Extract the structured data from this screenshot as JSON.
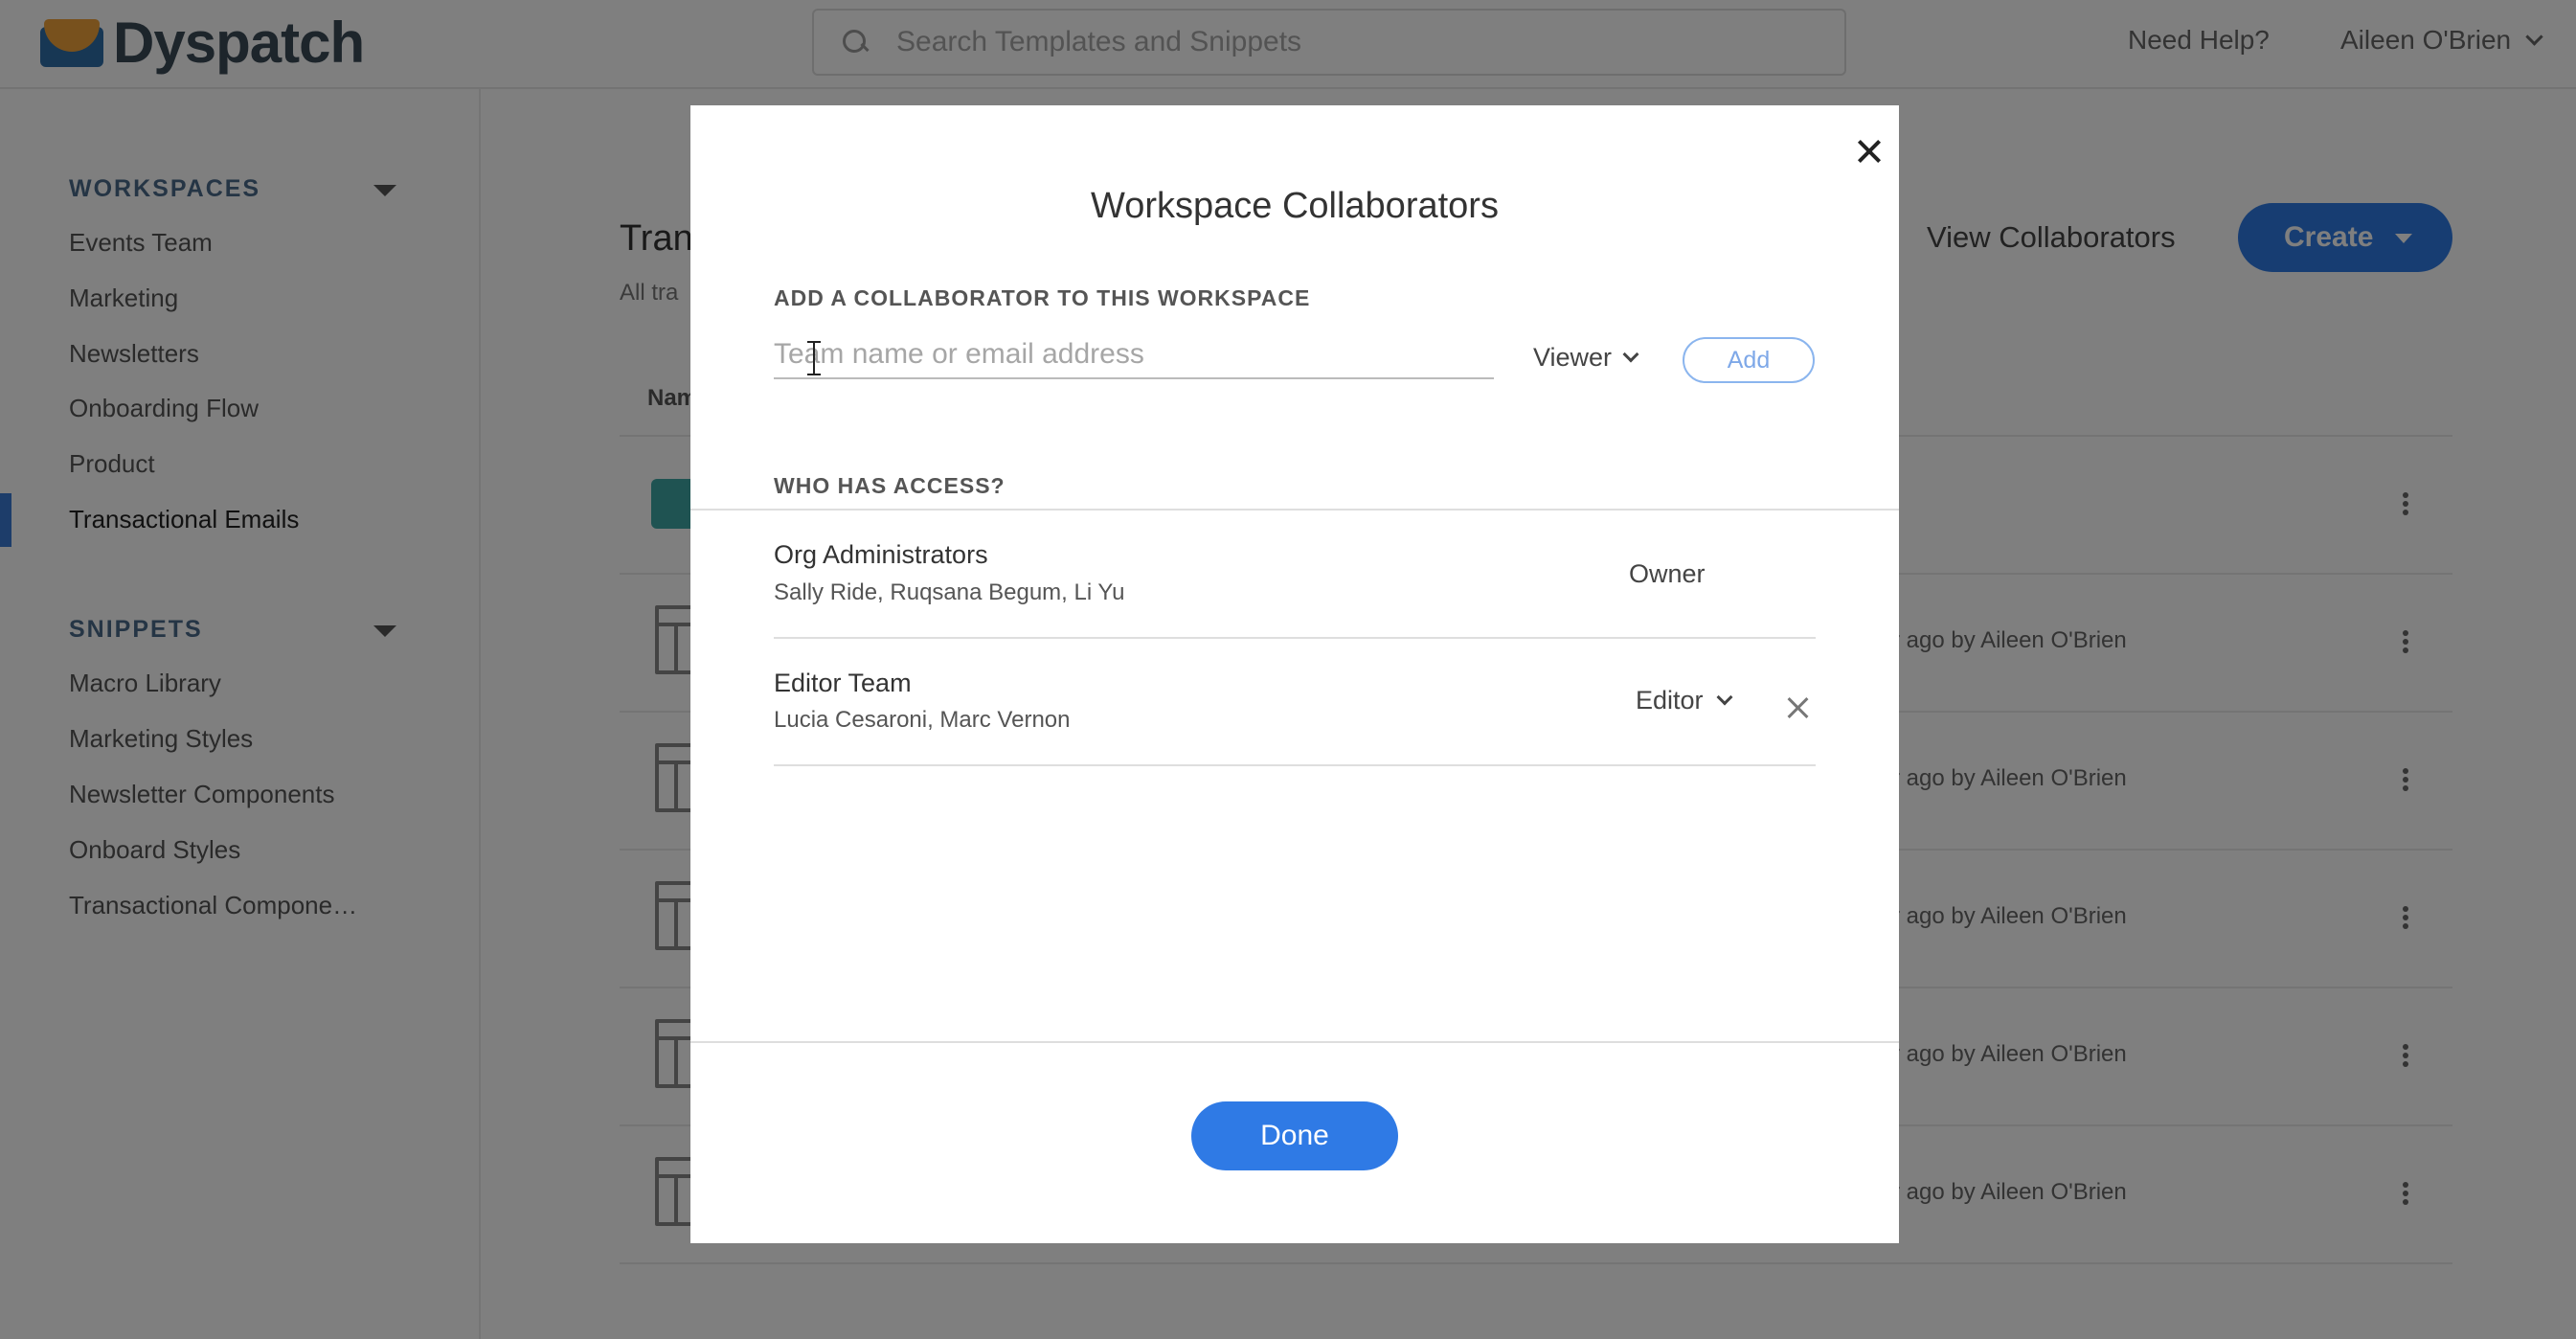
{
  "header": {
    "brand": "Dyspatch",
    "search_placeholder": "Search Templates and Snippets",
    "help_label": "Need Help?",
    "user_name": "Aileen O'Brien"
  },
  "sidebar": {
    "workspaces_title": "WORKSPACES",
    "workspaces": [
      "Events Team",
      "Marketing",
      "Newsletters",
      "Onboarding Flow",
      "Product",
      "Transactional Emails"
    ],
    "active_workspace": "Transactional Emails",
    "snippets_title": "SNIPPETS",
    "snippets": [
      "Macro Library",
      "Marketing Styles",
      "Newsletter Components",
      "Onboard Styles",
      "Transactional Compone…"
    ]
  },
  "main": {
    "title_partial": "Tran",
    "subtitle_partial": "All tra",
    "column_name_partial": "Nam",
    "view_collaborators_label": "View Collaborators",
    "create_label": "Create",
    "row_meta": [
      "r ago by Aileen O'Brien",
      "r ago by Aileen O'Brien",
      "r ago by Aileen O'Brien",
      "r ago by Aileen O'Brien",
      "r ago by Aileen O'Brien"
    ]
  },
  "modal": {
    "title": "Workspace Collaborators",
    "add_section_label": "ADD A COLLABORATOR TO THIS WORKSPACE",
    "input_placeholder": "Team name or email address",
    "role_selected": "Viewer",
    "add_label": "Add",
    "access_section_label": "WHO HAS ACCESS?",
    "access_list": [
      {
        "name": "Org Administrators",
        "members": "Sally Ride, Ruqsana Begum, Li Yu",
        "role": "Owner",
        "removable": false
      },
      {
        "name": "Editor Team",
        "members": "Lucia Cesaroni, Marc Vernon",
        "role": "Editor",
        "removable": true
      }
    ],
    "done_label": "Done"
  },
  "colors": {
    "accent": "#2f7ae5",
    "overlay": "rgba(0,0,0,0.5)"
  }
}
